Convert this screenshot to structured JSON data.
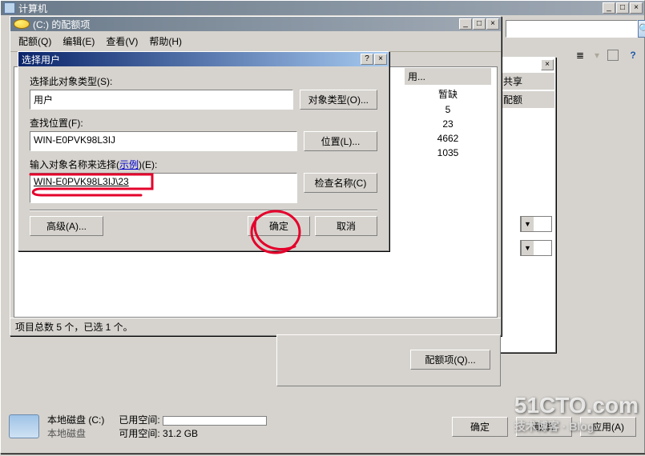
{
  "explorer": {
    "title": "计算机",
    "search_placeholder": "",
    "min": "_",
    "max": "□",
    "close": "×"
  },
  "toolbar": {
    "icon1": "organize-icon",
    "icon2": "view-icon",
    "icon3": "help-icon"
  },
  "quota_window": {
    "title": "(C:) 的配额项",
    "menu": {
      "quota": "配额(Q)",
      "edit": "编辑(E)",
      "view": "查看(V)",
      "help": "帮助(H)"
    },
    "status": "项目总数 5 个，已选 1 个。",
    "grid_header_used": "用...",
    "grid_header_share": "共享",
    "grid_header_quota": "配额",
    "rows": [
      "暂缺",
      "5",
      "23",
      "4662",
      "1035"
    ],
    "quota_item_btn": "配额项(Q)..."
  },
  "dialog": {
    "title": "选择用户",
    "lbl_object_type": "选择此对象类型(S):",
    "object_type_value": "用户",
    "btn_object_type": "对象类型(O)...",
    "lbl_location": "查找位置(F):",
    "location_value": "WIN-E0PVK98L3IJ",
    "btn_location": "位置(L)...",
    "lbl_names": "输入对象名称来选择(",
    "link_example": "示例",
    "lbl_names_suffix": ")(E):",
    "names_value": "WIN-E0PVK98L3IJ\\23",
    "btn_check": "检查名称(C)",
    "btn_advanced": "高级(A)...",
    "btn_ok": "确定",
    "btn_cancel": "取消"
  },
  "bottom": {
    "drive_label": "本地磁盘 (C:)",
    "drive_type": "本地磁盘",
    "used_label": "已用空间:",
    "avail_label": "可用空间:",
    "avail_value": "31.2 GB",
    "ok": "确定",
    "cancel": "取消",
    "apply": "应用(A)"
  },
  "side_grid": {
    "close": "×"
  },
  "watermark": {
    "main": "51CTO.com",
    "sub": "技术博客 · Blog"
  }
}
